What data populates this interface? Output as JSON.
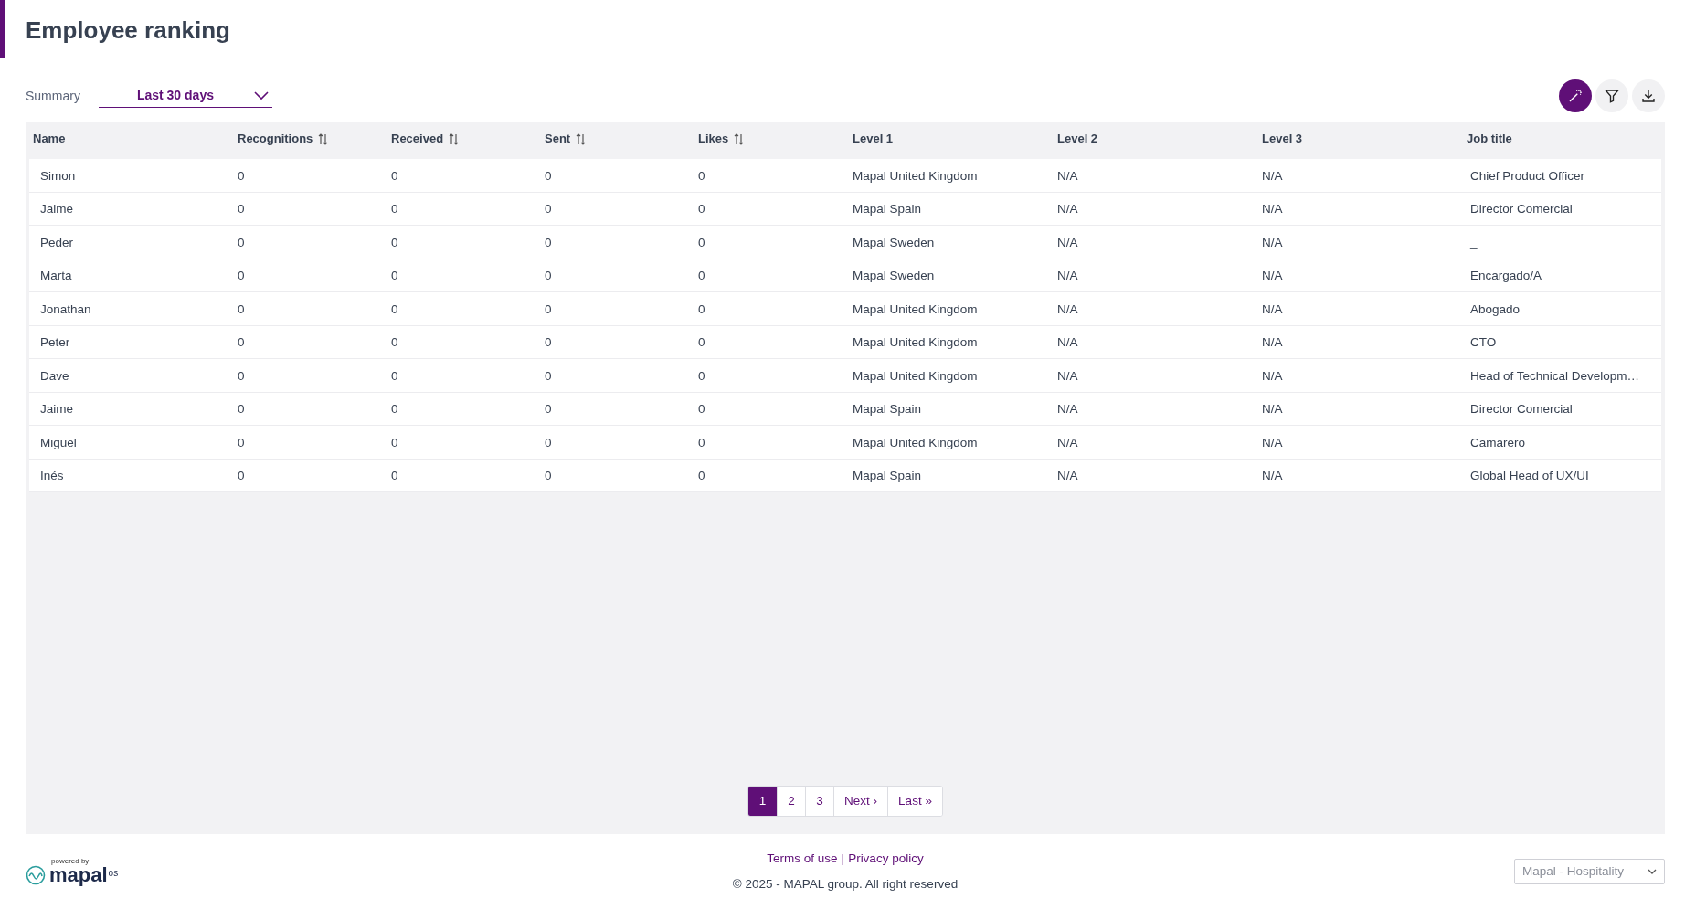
{
  "page": {
    "title": "Employee ranking"
  },
  "summary": {
    "label": "Summary",
    "value": "Last 30 days"
  },
  "toolbar": [
    {
      "kind": "wand",
      "selected": true
    },
    {
      "kind": "filter",
      "selected": false
    },
    {
      "kind": "download",
      "selected": false
    }
  ],
  "table": {
    "columns": [
      {
        "label": "Name",
        "sortable": false
      },
      {
        "label": "Recognitions",
        "sortable": true
      },
      {
        "label": "Received",
        "sortable": true
      },
      {
        "label": "Sent",
        "sortable": true
      },
      {
        "label": "Likes",
        "sortable": true
      },
      {
        "label": "Level 1",
        "sortable": false
      },
      {
        "label": "Level 2",
        "sortable": false
      },
      {
        "label": "Level 3",
        "sortable": false
      },
      {
        "label": "Job title",
        "sortable": false
      }
    ],
    "rows": [
      [
        "Simon",
        "0",
        "0",
        "0",
        "0",
        "Mapal United Kingdom",
        "N/A",
        "N/A",
        "Chief Product Officer"
      ],
      [
        "Jaime",
        "0",
        "0",
        "0",
        "0",
        "Mapal Spain",
        "N/A",
        "N/A",
        "Director Comercial"
      ],
      [
        "Peder",
        "0",
        "0",
        "0",
        "0",
        "Mapal Sweden",
        "N/A",
        "N/A",
        "_"
      ],
      [
        "Marta",
        "0",
        "0",
        "0",
        "0",
        "Mapal Sweden",
        "N/A",
        "N/A",
        "Encargado/A"
      ],
      [
        "Jonathan",
        "0",
        "0",
        "0",
        "0",
        "Mapal United Kingdom",
        "N/A",
        "N/A",
        "Abogado"
      ],
      [
        "Peter",
        "0",
        "0",
        "0",
        "0",
        "Mapal United Kingdom",
        "N/A",
        "N/A",
        "CTO"
      ],
      [
        "Dave",
        "0",
        "0",
        "0",
        "0",
        "Mapal United Kingdom",
        "N/A",
        "N/A",
        "Head of Technical Developm…"
      ],
      [
        "Jaime",
        "0",
        "0",
        "0",
        "0",
        "Mapal Spain",
        "N/A",
        "N/A",
        "Director Comercial"
      ],
      [
        "Miguel",
        "0",
        "0",
        "0",
        "0",
        "Mapal United Kingdom",
        "N/A",
        "N/A",
        "Camarero"
      ],
      [
        "Inés",
        "0",
        "0",
        "0",
        "0",
        "Mapal Spain",
        "N/A",
        "N/A",
        "Global Head of UX/UI"
      ]
    ]
  },
  "pagination": [
    {
      "label": "1",
      "selected": true
    },
    {
      "label": "2",
      "selected": false
    },
    {
      "label": "3",
      "selected": false
    },
    {
      "label": "Next ›",
      "selected": false
    },
    {
      "label": "Last »",
      "selected": false
    }
  ],
  "footer": {
    "powered_by": "powered by",
    "logo_text": "mapal",
    "logo_suffix": "os",
    "links": [
      "Terms of use",
      "Privacy policy"
    ],
    "separator": "|",
    "copyright": "© 2025 - MAPAL group. All right reserved",
    "company_select": "Mapal - Hospitality"
  }
}
